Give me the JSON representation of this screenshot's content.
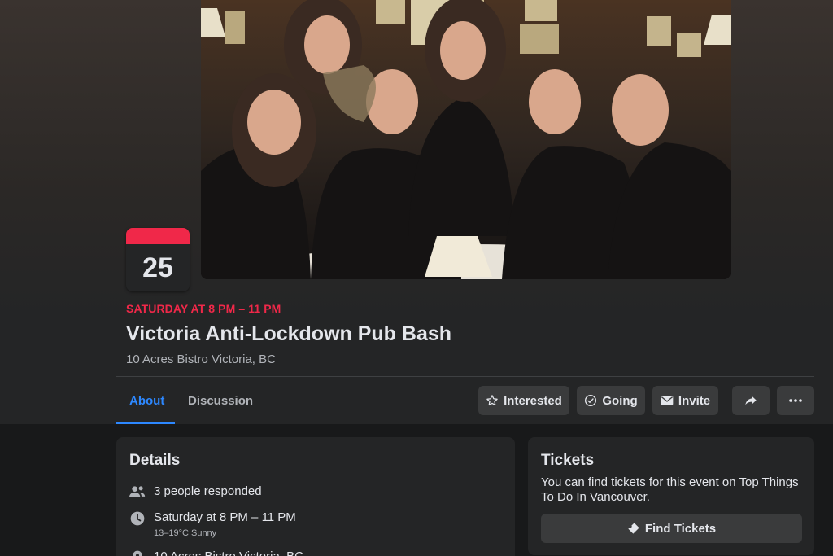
{
  "event": {
    "date_day": "25",
    "when": "SATURDAY AT 8 PM – 11 PM",
    "title": "Victoria Anti-Lockdown Pub Bash",
    "location": "10 Acres Bistro Victoria, BC",
    "accent_color": "#f02849"
  },
  "tabs": [
    {
      "label": "About",
      "active": true
    },
    {
      "label": "Discussion",
      "active": false
    }
  ],
  "actions": {
    "interested": {
      "label": "Interested",
      "icon": "star-icon"
    },
    "going": {
      "label": "Going",
      "icon": "check-circle-icon"
    },
    "invite": {
      "label": "Invite",
      "icon": "envelope-icon"
    },
    "share": {
      "icon": "share-icon"
    },
    "more": {
      "icon": "more-icon"
    }
  },
  "details": {
    "title": "Details",
    "responded": "3 people responded",
    "time": "Saturday at 8 PM – 11 PM",
    "weather": "13–19°C Sunny",
    "location_partial": "10 Acres Bistro Victoria, BC"
  },
  "tickets": {
    "title": "Tickets",
    "text": "You can find tickets for this event on Top Things To Do In Vancouver.",
    "button": "Find Tickets"
  },
  "colors": {
    "link_blue": "#2d88ff",
    "card_bg": "#242526",
    "button_bg": "#3a3b3c"
  }
}
